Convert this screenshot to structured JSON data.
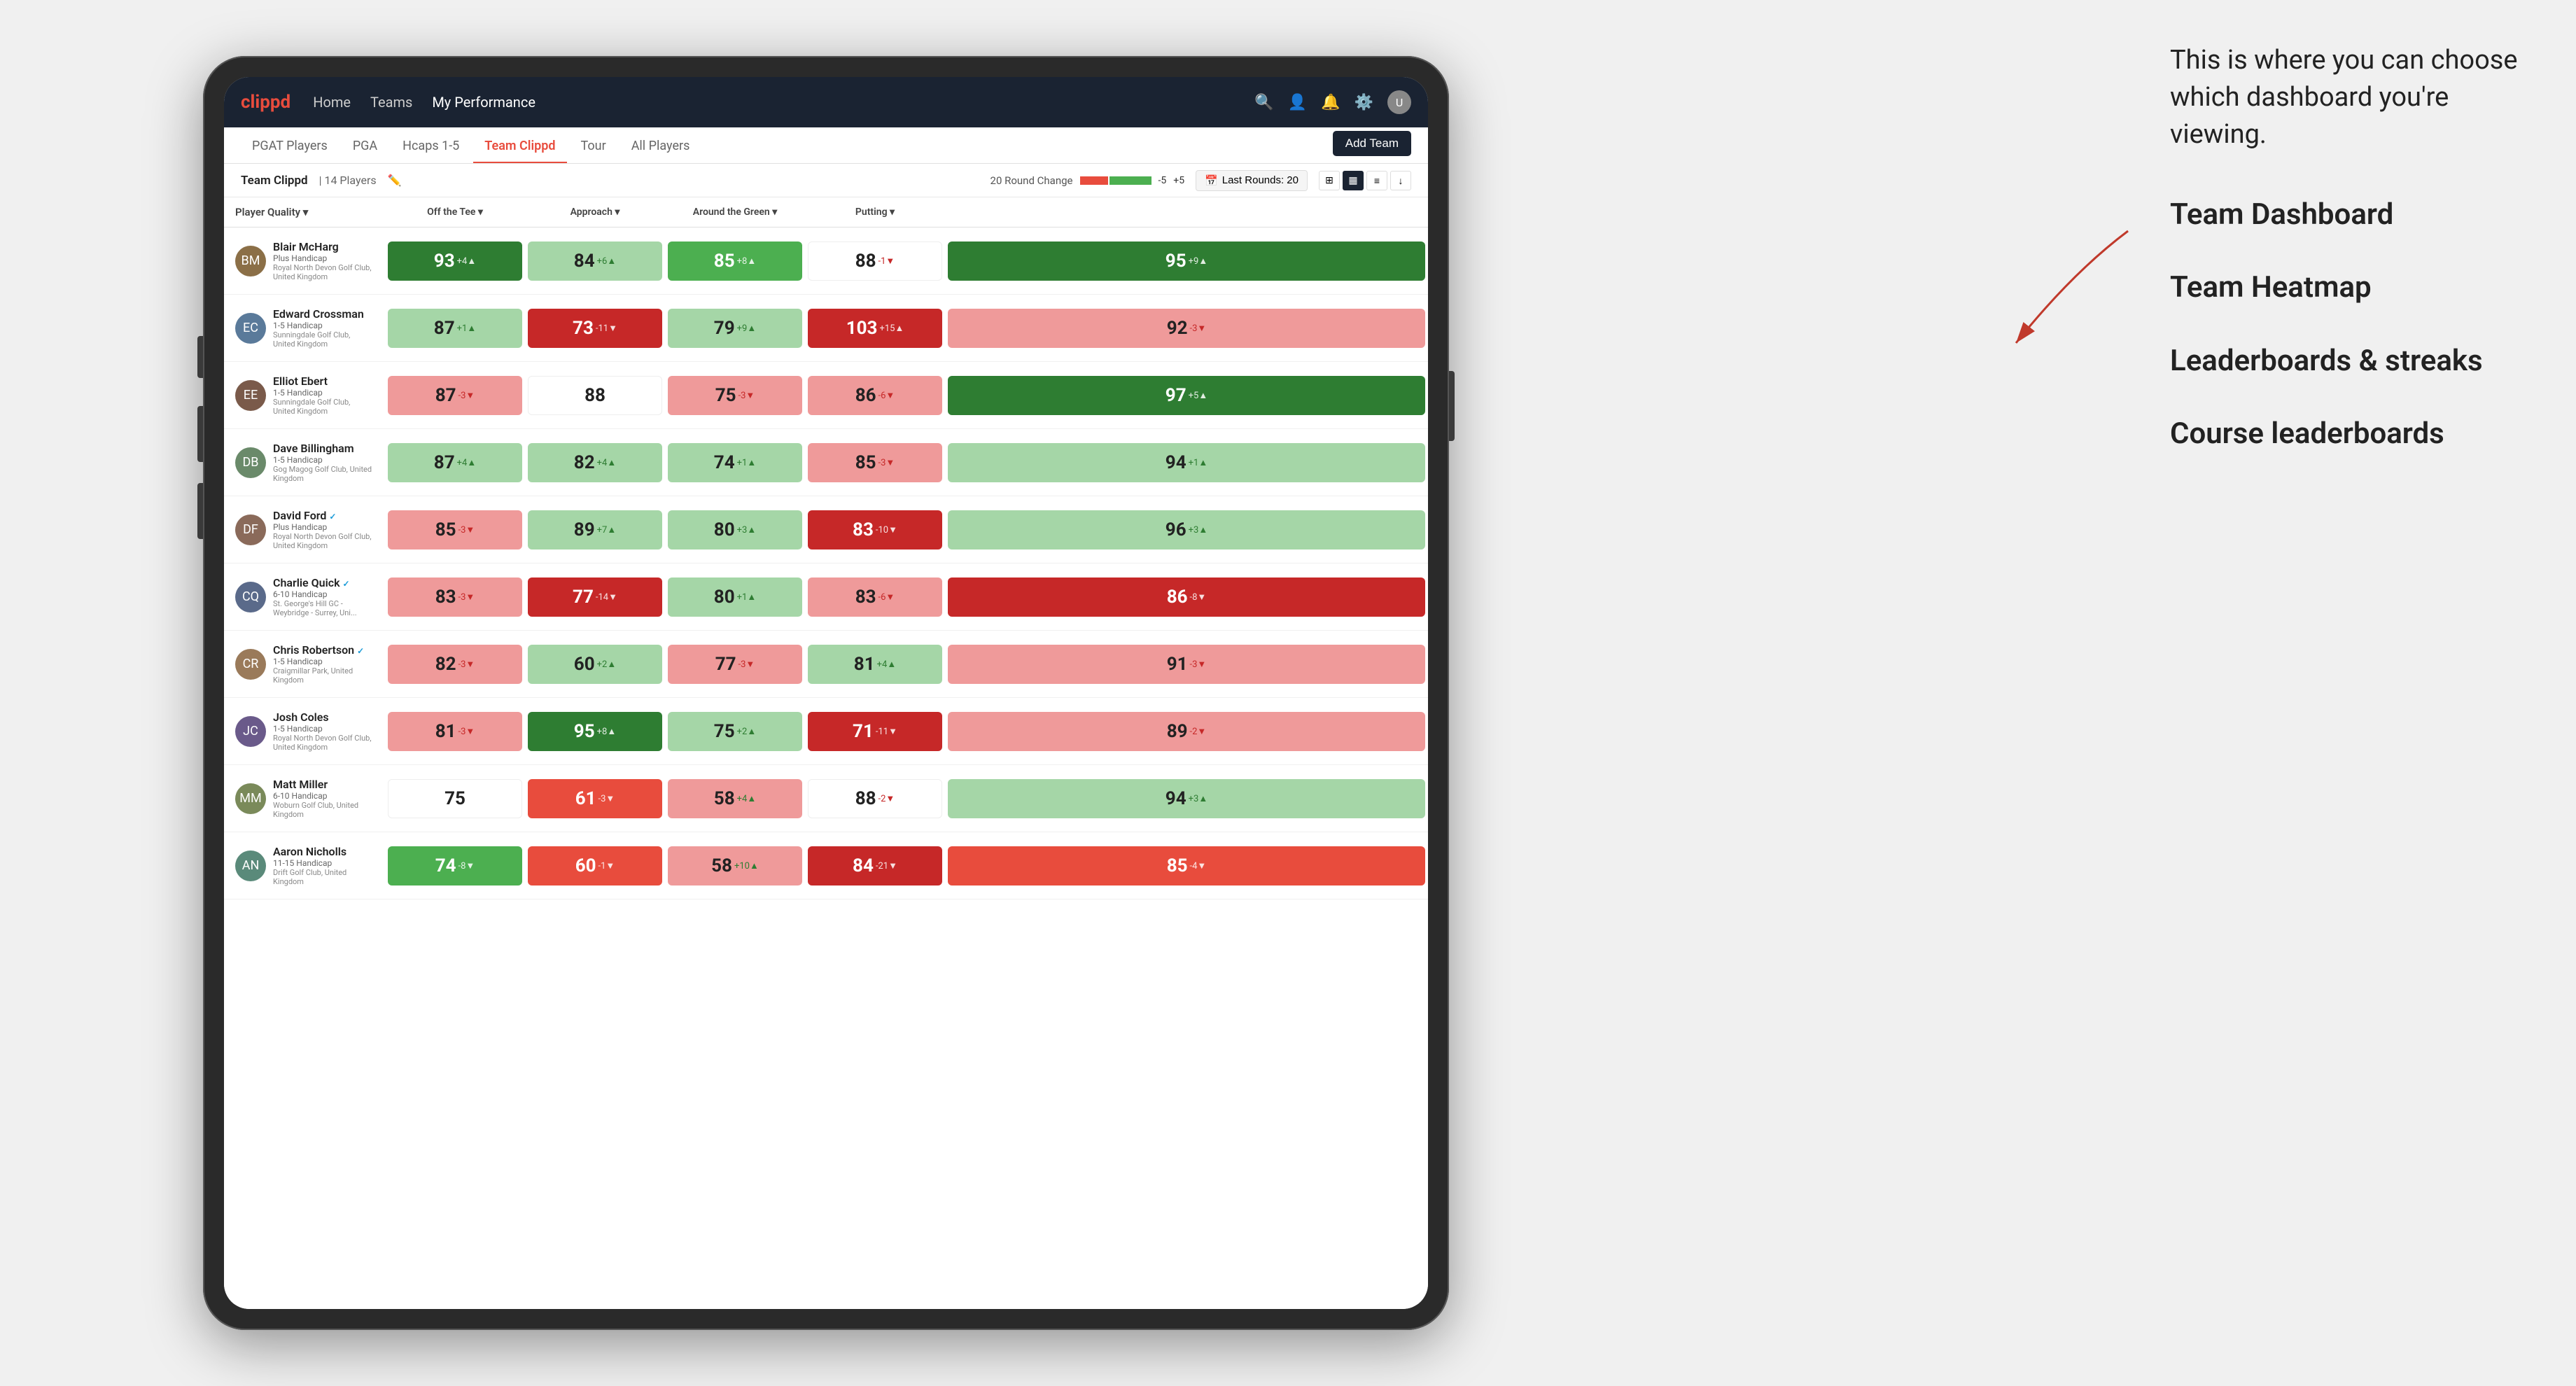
{
  "annotation": {
    "intro_text": "This is where you can choose which dashboard you're viewing.",
    "options": [
      {
        "label": "Team Dashboard"
      },
      {
        "label": "Team Heatmap"
      },
      {
        "label": "Leaderboards & streaks"
      },
      {
        "label": "Course leaderboards"
      }
    ]
  },
  "nav": {
    "logo": "clippd",
    "items": [
      {
        "label": "Home",
        "active": false
      },
      {
        "label": "Teams",
        "active": false
      },
      {
        "label": "My Performance",
        "active": true
      }
    ],
    "right_icons": [
      "search",
      "person",
      "bell",
      "settings",
      "avatar"
    ]
  },
  "tabs": [
    {
      "label": "PGAT Players",
      "active": false
    },
    {
      "label": "PGA",
      "active": false
    },
    {
      "label": "Hcaps 1-5",
      "active": false
    },
    {
      "label": "Team Clippd",
      "active": true
    },
    {
      "label": "Tour",
      "active": false
    },
    {
      "label": "All Players",
      "active": false
    }
  ],
  "add_team_label": "Add Team",
  "sub_header": {
    "team_label": "Team Clippd",
    "player_count": "| 14 Players",
    "round_change_label": "20 Round Change",
    "neg_label": "-5",
    "pos_label": "+5",
    "last_rounds_label": "Last Rounds: 20"
  },
  "table_headers": {
    "player": "Player Quality ▾",
    "off_tee": "Off the Tee ▾",
    "approach": "Approach ▾",
    "around_green": "Around the Green ▾",
    "putting": "Putting ▾"
  },
  "players": [
    {
      "name": "Blair McHarg",
      "handicap": "Plus Handicap",
      "club": "Royal North Devon Golf Club, United Kingdom",
      "avatar_color": "#8B6F47",
      "metrics": {
        "player_quality": {
          "value": 93,
          "change": "+4",
          "dir": "up",
          "color": "green-dark"
        },
        "off_tee": {
          "value": 84,
          "change": "+6",
          "dir": "up",
          "color": "green-light"
        },
        "approach": {
          "value": 85,
          "change": "+8",
          "dir": "up",
          "color": "green-med"
        },
        "around_green": {
          "value": 88,
          "change": "-1",
          "dir": "down",
          "color": "white"
        },
        "putting": {
          "value": 95,
          "change": "+9",
          "dir": "up",
          "color": "green-dark"
        }
      }
    },
    {
      "name": "Edward Crossman",
      "handicap": "1-5 Handicap",
      "club": "Sunningdale Golf Club, United Kingdom",
      "avatar_color": "#5a7a9a",
      "metrics": {
        "player_quality": {
          "value": 87,
          "change": "+1",
          "dir": "up",
          "color": "green-light"
        },
        "off_tee": {
          "value": 73,
          "change": "-11",
          "dir": "down",
          "color": "red-dark"
        },
        "approach": {
          "value": 79,
          "change": "+9",
          "dir": "up",
          "color": "green-light"
        },
        "around_green": {
          "value": 103,
          "change": "+15",
          "dir": "up",
          "color": "red-dark"
        },
        "putting": {
          "value": 92,
          "change": "-3",
          "dir": "down",
          "color": "red-light"
        }
      }
    },
    {
      "name": "Elliot Ebert",
      "handicap": "1-5 Handicap",
      "club": "Sunningdale Golf Club, United Kingdom",
      "avatar_color": "#7a5a4a",
      "metrics": {
        "player_quality": {
          "value": 87,
          "change": "-3",
          "dir": "down",
          "color": "red-light"
        },
        "off_tee": {
          "value": 88,
          "change": "",
          "dir": "",
          "color": "white"
        },
        "approach": {
          "value": 75,
          "change": "-3",
          "dir": "down",
          "color": "red-light"
        },
        "around_green": {
          "value": 86,
          "change": "-6",
          "dir": "down",
          "color": "red-light"
        },
        "putting": {
          "value": 97,
          "change": "+5",
          "dir": "up",
          "color": "green-dark"
        }
      }
    },
    {
      "name": "Dave Billingham",
      "handicap": "1-5 Handicap",
      "club": "Gog Magog Golf Club, United Kingdom",
      "avatar_color": "#6a8a6a",
      "metrics": {
        "player_quality": {
          "value": 87,
          "change": "+4",
          "dir": "up",
          "color": "green-light"
        },
        "off_tee": {
          "value": 82,
          "change": "+4",
          "dir": "up",
          "color": "green-light"
        },
        "approach": {
          "value": 74,
          "change": "+1",
          "dir": "up",
          "color": "green-light"
        },
        "around_green": {
          "value": 85,
          "change": "-3",
          "dir": "down",
          "color": "red-light"
        },
        "putting": {
          "value": 94,
          "change": "+1",
          "dir": "up",
          "color": "green-light"
        }
      }
    },
    {
      "name": "David Ford",
      "handicap": "Plus Handicap",
      "club": "Royal North Devon Golf Club, United Kingdom",
      "avatar_color": "#8a6a5a",
      "verified": true,
      "metrics": {
        "player_quality": {
          "value": 85,
          "change": "-3",
          "dir": "down",
          "color": "red-light"
        },
        "off_tee": {
          "value": 89,
          "change": "+7",
          "dir": "up",
          "color": "green-light"
        },
        "approach": {
          "value": 80,
          "change": "+3",
          "dir": "up",
          "color": "green-light"
        },
        "around_green": {
          "value": 83,
          "change": "-10",
          "dir": "down",
          "color": "red-dark"
        },
        "putting": {
          "value": 96,
          "change": "+3",
          "dir": "up",
          "color": "green-light"
        }
      }
    },
    {
      "name": "Charlie Quick",
      "handicap": "6-10 Handicap",
      "club": "St. George's Hill GC - Weybridge - Surrey, Uni...",
      "avatar_color": "#5a6a8a",
      "verified": true,
      "metrics": {
        "player_quality": {
          "value": 83,
          "change": "-3",
          "dir": "down",
          "color": "red-light"
        },
        "off_tee": {
          "value": 77,
          "change": "-14",
          "dir": "down",
          "color": "red-dark"
        },
        "approach": {
          "value": 80,
          "change": "+1",
          "dir": "up",
          "color": "green-light"
        },
        "around_green": {
          "value": 83,
          "change": "-6",
          "dir": "down",
          "color": "red-light"
        },
        "putting": {
          "value": 86,
          "change": "-8",
          "dir": "down",
          "color": "red-dark"
        }
      }
    },
    {
      "name": "Chris Robertson",
      "handicap": "1-5 Handicap",
      "club": "Craigmillar Park, United Kingdom",
      "avatar_color": "#9a7a5a",
      "verified": true,
      "metrics": {
        "player_quality": {
          "value": 82,
          "change": "-3",
          "dir": "down",
          "color": "red-light"
        },
        "off_tee": {
          "value": 60,
          "change": "+2",
          "dir": "up",
          "color": "green-light"
        },
        "approach": {
          "value": 77,
          "change": "-3",
          "dir": "down",
          "color": "red-light"
        },
        "around_green": {
          "value": 81,
          "change": "+4",
          "dir": "up",
          "color": "green-light"
        },
        "putting": {
          "value": 91,
          "change": "-3",
          "dir": "down",
          "color": "red-light"
        }
      }
    },
    {
      "name": "Josh Coles",
      "handicap": "1-5 Handicap",
      "club": "Royal North Devon Golf Club, United Kingdom",
      "avatar_color": "#6a5a8a",
      "metrics": {
        "player_quality": {
          "value": 81,
          "change": "-3",
          "dir": "down",
          "color": "red-light"
        },
        "off_tee": {
          "value": 95,
          "change": "+8",
          "dir": "up",
          "color": "green-dark"
        },
        "approach": {
          "value": 75,
          "change": "+2",
          "dir": "up",
          "color": "green-light"
        },
        "around_green": {
          "value": 71,
          "change": "-11",
          "dir": "down",
          "color": "red-dark"
        },
        "putting": {
          "value": 89,
          "change": "-2",
          "dir": "down",
          "color": "red-light"
        }
      }
    },
    {
      "name": "Matt Miller",
      "handicap": "6-10 Handicap",
      "club": "Woburn Golf Club, United Kingdom",
      "avatar_color": "#7a8a5a",
      "metrics": {
        "player_quality": {
          "value": 75,
          "change": "",
          "dir": "",
          "color": "white"
        },
        "off_tee": {
          "value": 61,
          "change": "-3",
          "dir": "down",
          "color": "red-med"
        },
        "approach": {
          "value": 58,
          "change": "+4",
          "dir": "up",
          "color": "red-light"
        },
        "around_green": {
          "value": 88,
          "change": "-2",
          "dir": "down",
          "color": "white"
        },
        "putting": {
          "value": 94,
          "change": "+3",
          "dir": "up",
          "color": "green-light"
        }
      }
    },
    {
      "name": "Aaron Nicholls",
      "handicap": "11-15 Handicap",
      "club": "Drift Golf Club, United Kingdom",
      "avatar_color": "#5a8a7a",
      "metrics": {
        "player_quality": {
          "value": 74,
          "change": "-8",
          "dir": "down",
          "color": "green-med"
        },
        "off_tee": {
          "value": 60,
          "change": "-1",
          "dir": "down",
          "color": "red-med"
        },
        "approach": {
          "value": 58,
          "change": "+10",
          "dir": "up",
          "color": "red-light"
        },
        "around_green": {
          "value": 84,
          "change": "-21",
          "dir": "down",
          "color": "red-dark"
        },
        "putting": {
          "value": 85,
          "change": "-4",
          "dir": "down",
          "color": "red-med"
        }
      }
    }
  ]
}
